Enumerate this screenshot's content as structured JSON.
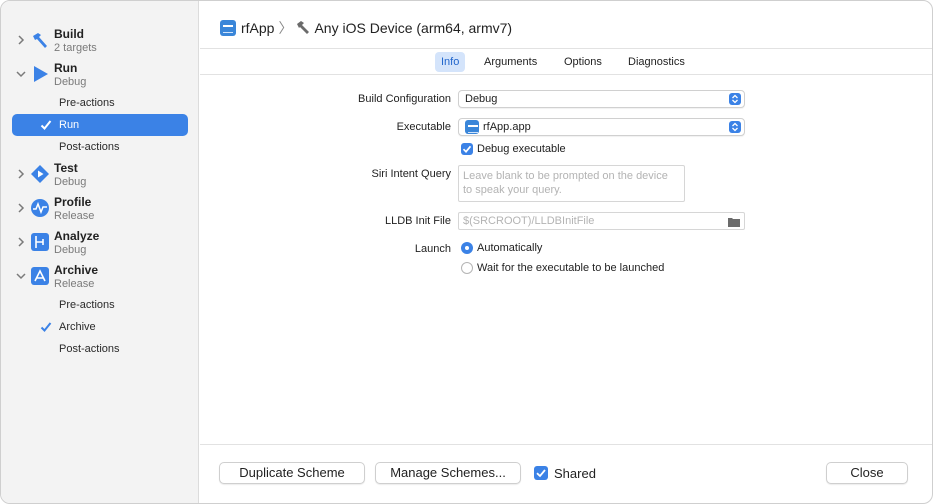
{
  "sidebar": {
    "actions": [
      {
        "title": "Build",
        "subtitle": "2 targets",
        "expanded": false,
        "icon": "hammer-icon"
      },
      {
        "title": "Run",
        "subtitle": "Debug",
        "expanded": true,
        "icon": "play-icon",
        "items": [
          "Pre-actions",
          "Run",
          "Post-actions"
        ]
      },
      {
        "title": "Test",
        "subtitle": "Debug",
        "expanded": false,
        "icon": "test-diamond-icon"
      },
      {
        "title": "Profile",
        "subtitle": "Release",
        "expanded": false,
        "icon": "waveform-icon"
      },
      {
        "title": "Analyze",
        "subtitle": "Debug",
        "expanded": false,
        "icon": "analyze-icon"
      },
      {
        "title": "Archive",
        "subtitle": "Release",
        "expanded": true,
        "icon": "archive-icon",
        "items": [
          "Pre-actions",
          "Archive",
          "Post-actions"
        ]
      }
    ],
    "selected": "Run"
  },
  "header": {
    "project": "rfApp",
    "destination": "Any iOS Device (arm64, armv7)"
  },
  "tabs": [
    "Info",
    "Arguments",
    "Options",
    "Diagnostics"
  ],
  "active_tab": "Info",
  "form": {
    "build_configuration_label": "Build Configuration",
    "build_configuration_value": "Debug",
    "executable_label": "Executable",
    "executable_value": "rfApp.app",
    "debug_executable_label": "Debug executable",
    "debug_executable_checked": true,
    "siri_label": "Siri Intent Query",
    "siri_placeholder": "Leave blank to be prompted on the device to speak your query.",
    "lldb_label": "LLDB Init File",
    "lldb_placeholder": "$(SRCROOT)/LLDBInitFile",
    "launch_label": "Launch",
    "launch_options": [
      "Automatically",
      "Wait for the executable to be launched"
    ],
    "launch_selected": "Automatically"
  },
  "footer": {
    "duplicate_label": "Duplicate Scheme",
    "manage_label": "Manage Schemes...",
    "shared_label": "Shared",
    "shared_checked": true,
    "close_label": "Close"
  },
  "colors": {
    "accent": "#3b82e6",
    "sidebar_bg": "#f3f3f3"
  }
}
